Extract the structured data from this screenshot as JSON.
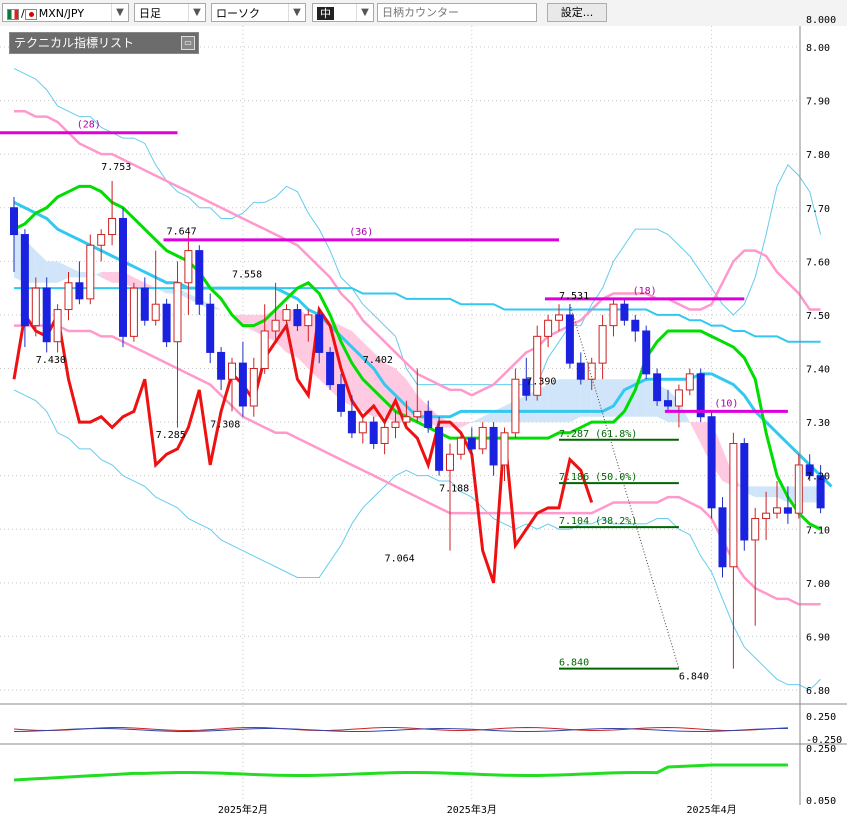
{
  "toolbar": {
    "pair": "MXN/JPY",
    "pair_separator": "/",
    "period": "日足",
    "chart_type": "ローソク",
    "size": "中",
    "counter_placeholder": "日柄カウンター",
    "settings_label": "設定..."
  },
  "indicator_panel": {
    "title": "テクニカル指標リスト"
  },
  "colors": {
    "up_candle": "#ffffff",
    "down_candle": "#1a22e0",
    "wick": "#cc2222",
    "ma_short": "#00dd00",
    "ma_long": "#33c8f0",
    "bollinger_outer": "#66ccee",
    "bollinger_inner": "#ff99cc",
    "cloud": "#ffc0dc",
    "cloud_alt": "#c8e0f8",
    "rsi_line": "#ee1111",
    "high_line": "#dd00dd",
    "fibonacci": "#006600"
  },
  "chart_data": {
    "type": "candlestick",
    "title": "",
    "instrument": "MXN/JPY",
    "timeframe": "daily",
    "y_range": [
      6.78,
      8.02
    ],
    "y_ticks": [
      "8.00",
      "7.90",
      "7.80",
      "7.70",
      "7.60",
      "7.50",
      "7.40",
      "7.30",
      "7.20",
      "7.10",
      "7.00",
      "6.90",
      "6.80"
    ],
    "y_top_partial": "8.000",
    "x_labels": [
      "2025年2月",
      "2025年3月",
      "2025年4月"
    ],
    "x_label_bars": [
      21,
      42,
      64
    ],
    "bars": 74,
    "candles": [
      {
        "o": 7.7,
        "h": 7.72,
        "l": 7.58,
        "c": 7.65
      },
      {
        "o": 7.65,
        "h": 7.66,
        "l": 7.44,
        "c": 7.48
      },
      {
        "o": 7.48,
        "h": 7.57,
        "l": 7.46,
        "c": 7.55
      },
      {
        "o": 7.55,
        "h": 7.57,
        "l": 7.43,
        "c": 7.45
      },
      {
        "o": 7.45,
        "h": 7.52,
        "l": 7.43,
        "c": 7.51
      },
      {
        "o": 7.51,
        "h": 7.58,
        "l": 7.49,
        "c": 7.56
      },
      {
        "o": 7.56,
        "h": 7.6,
        "l": 7.52,
        "c": 7.53
      },
      {
        "o": 7.53,
        "h": 7.65,
        "l": 7.52,
        "c": 7.63
      },
      {
        "o": 7.63,
        "h": 7.66,
        "l": 7.6,
        "c": 7.65
      },
      {
        "o": 7.65,
        "h": 7.75,
        "l": 7.63,
        "c": 7.68
      },
      {
        "o": 7.68,
        "h": 7.7,
        "l": 7.44,
        "c": 7.46
      },
      {
        "o": 7.46,
        "h": 7.56,
        "l": 7.45,
        "c": 7.55
      },
      {
        "o": 7.55,
        "h": 7.57,
        "l": 7.48,
        "c": 7.49
      },
      {
        "o": 7.49,
        "h": 7.62,
        "l": 7.48,
        "c": 7.52
      },
      {
        "o": 7.52,
        "h": 7.53,
        "l": 7.44,
        "c": 7.45
      },
      {
        "o": 7.45,
        "h": 7.6,
        "l": 7.29,
        "c": 7.56
      },
      {
        "o": 7.56,
        "h": 7.65,
        "l": 7.5,
        "c": 7.62
      },
      {
        "o": 7.62,
        "h": 7.63,
        "l": 7.5,
        "c": 7.52
      },
      {
        "o": 7.52,
        "h": 7.54,
        "l": 7.41,
        "c": 7.43
      },
      {
        "o": 7.43,
        "h": 7.44,
        "l": 7.36,
        "c": 7.38
      },
      {
        "o": 7.38,
        "h": 7.42,
        "l": 7.32,
        "c": 7.41
      },
      {
        "o": 7.41,
        "h": 7.45,
        "l": 7.31,
        "c": 7.33
      },
      {
        "o": 7.33,
        "h": 7.42,
        "l": 7.31,
        "c": 7.4
      },
      {
        "o": 7.4,
        "h": 7.52,
        "l": 7.39,
        "c": 7.47
      },
      {
        "o": 7.47,
        "h": 7.56,
        "l": 7.45,
        "c": 7.49
      },
      {
        "o": 7.49,
        "h": 7.52,
        "l": 7.47,
        "c": 7.51
      },
      {
        "o": 7.51,
        "h": 7.52,
        "l": 7.47,
        "c": 7.48
      },
      {
        "o": 7.48,
        "h": 7.51,
        "l": 7.45,
        "c": 7.5
      },
      {
        "o": 7.5,
        "h": 7.51,
        "l": 7.41,
        "c": 7.43
      },
      {
        "o": 7.43,
        "h": 7.44,
        "l": 7.36,
        "c": 7.37
      },
      {
        "o": 7.37,
        "h": 7.39,
        "l": 7.31,
        "c": 7.32
      },
      {
        "o": 7.32,
        "h": 7.35,
        "l": 7.27,
        "c": 7.28
      },
      {
        "o": 7.28,
        "h": 7.31,
        "l": 7.26,
        "c": 7.3
      },
      {
        "o": 7.3,
        "h": 7.31,
        "l": 7.25,
        "c": 7.26
      },
      {
        "o": 7.26,
        "h": 7.3,
        "l": 7.24,
        "c": 7.29
      },
      {
        "o": 7.29,
        "h": 7.32,
        "l": 7.27,
        "c": 7.3
      },
      {
        "o": 7.3,
        "h": 7.34,
        "l": 7.29,
        "c": 7.31
      },
      {
        "o": 7.31,
        "h": 7.4,
        "l": 7.3,
        "c": 7.32
      },
      {
        "o": 7.32,
        "h": 7.34,
        "l": 7.28,
        "c": 7.29
      },
      {
        "o": 7.29,
        "h": 7.31,
        "l": 7.2,
        "c": 7.21
      },
      {
        "o": 7.21,
        "h": 7.26,
        "l": 7.06,
        "c": 7.24
      },
      {
        "o": 7.24,
        "h": 7.28,
        "l": 7.23,
        "c": 7.27
      },
      {
        "o": 7.27,
        "h": 7.29,
        "l": 7.24,
        "c": 7.25
      },
      {
        "o": 7.25,
        "h": 7.3,
        "l": 7.24,
        "c": 7.29
      },
      {
        "o": 7.29,
        "h": 7.3,
        "l": 7.2,
        "c": 7.22
      },
      {
        "o": 7.22,
        "h": 7.29,
        "l": 7.19,
        "c": 7.28
      },
      {
        "o": 7.28,
        "h": 7.4,
        "l": 7.27,
        "c": 7.38
      },
      {
        "o": 7.38,
        "h": 7.42,
        "l": 7.34,
        "c": 7.35
      },
      {
        "o": 7.35,
        "h": 7.48,
        "l": 7.34,
        "c": 7.46
      },
      {
        "o": 7.46,
        "h": 7.5,
        "l": 7.44,
        "c": 7.49
      },
      {
        "o": 7.49,
        "h": 7.52,
        "l": 7.47,
        "c": 7.5
      },
      {
        "o": 7.5,
        "h": 7.52,
        "l": 7.4,
        "c": 7.41
      },
      {
        "o": 7.41,
        "h": 7.43,
        "l": 7.37,
        "c": 7.38
      },
      {
        "o": 7.38,
        "h": 7.42,
        "l": 7.36,
        "c": 7.41
      },
      {
        "o": 7.41,
        "h": 7.5,
        "l": 7.38,
        "c": 7.48
      },
      {
        "o": 7.48,
        "h": 7.53,
        "l": 7.46,
        "c": 7.52
      },
      {
        "o": 7.52,
        "h": 7.53,
        "l": 7.48,
        "c": 7.49
      },
      {
        "o": 7.49,
        "h": 7.5,
        "l": 7.45,
        "c": 7.47
      },
      {
        "o": 7.47,
        "h": 7.48,
        "l": 7.38,
        "c": 7.39
      },
      {
        "o": 7.39,
        "h": 7.4,
        "l": 7.33,
        "c": 7.34
      },
      {
        "o": 7.34,
        "h": 7.36,
        "l": 7.32,
        "c": 7.33
      },
      {
        "o": 7.33,
        "h": 7.37,
        "l": 7.29,
        "c": 7.36
      },
      {
        "o": 7.36,
        "h": 7.4,
        "l": 7.35,
        "c": 7.39
      },
      {
        "o": 7.39,
        "h": 7.4,
        "l": 7.3,
        "c": 7.31
      },
      {
        "o": 7.31,
        "h": 7.32,
        "l": 7.12,
        "c": 7.14
      },
      {
        "o": 7.14,
        "h": 7.16,
        "l": 7.01,
        "c": 7.03
      },
      {
        "o": 7.03,
        "h": 7.28,
        "l": 6.84,
        "c": 7.26
      },
      {
        "o": 7.26,
        "h": 7.27,
        "l": 7.06,
        "c": 7.08
      },
      {
        "o": 7.08,
        "h": 7.14,
        "l": 6.92,
        "c": 7.12
      },
      {
        "o": 7.12,
        "h": 7.17,
        "l": 7.08,
        "c": 7.13
      },
      {
        "o": 7.13,
        "h": 7.19,
        "l": 7.12,
        "c": 7.14
      },
      {
        "o": 7.14,
        "h": 7.18,
        "l": 7.11,
        "c": 7.13
      },
      {
        "o": 7.13,
        "h": 7.24,
        "l": 7.12,
        "c": 7.22
      },
      {
        "o": 7.22,
        "h": 7.24,
        "l": 7.19,
        "c": 7.2
      },
      {
        "o": 7.2,
        "h": 7.22,
        "l": 7.13,
        "c": 7.14
      }
    ],
    "ma_short": [
      7.66,
      7.67,
      7.69,
      7.7,
      7.72,
      7.73,
      7.74,
      7.74,
      7.73,
      7.71,
      7.7,
      7.68,
      7.66,
      7.64,
      7.62,
      7.61,
      7.6,
      7.58,
      7.55,
      7.53,
      7.5,
      7.48,
      7.48,
      7.49,
      7.51,
      7.53,
      7.55,
      7.56,
      7.54,
      7.5,
      7.45,
      7.41,
      7.38,
      7.36,
      7.34,
      7.32,
      7.31,
      7.3,
      7.29,
      7.28,
      7.27,
      7.27,
      7.27,
      7.27,
      7.27,
      7.27,
      7.27,
      7.27,
      7.27,
      7.27,
      7.28,
      7.28,
      7.29,
      7.3,
      7.3,
      7.3,
      7.32,
      7.36,
      7.42,
      7.45,
      7.47,
      7.47,
      7.47,
      7.47,
      7.46,
      7.45,
      7.44,
      7.42,
      7.38,
      7.28,
      7.2,
      7.16,
      7.13,
      7.11,
      7.1
    ],
    "ma_long": [
      7.71,
      7.7,
      7.69,
      7.68,
      7.66,
      7.65,
      7.64,
      7.63,
      7.62,
      7.61,
      7.6,
      7.59,
      7.58,
      7.57,
      7.56,
      7.56,
      7.55,
      7.55,
      7.55,
      7.55,
      7.55,
      7.55,
      7.55,
      7.55,
      7.55,
      7.54,
      7.53,
      7.51,
      7.5,
      7.48,
      7.46,
      7.44,
      7.42,
      7.4,
      7.37,
      7.35,
      7.33,
      7.31,
      7.31,
      7.31,
      7.31,
      7.32,
      7.32,
      7.32,
      7.32,
      7.32,
      7.32,
      7.32,
      7.32,
      7.32,
      7.32,
      7.32,
      7.32,
      7.32,
      7.32,
      7.33,
      7.36,
      7.37,
      7.38,
      7.38,
      7.38,
      7.38,
      7.38,
      7.39,
      7.39,
      7.38,
      7.37,
      7.35,
      7.32,
      7.3,
      7.28,
      7.26,
      7.24,
      7.22,
      7.2,
      7.18
    ],
    "ma_long2": [
      7.55,
      7.55,
      7.55,
      7.55,
      7.55,
      7.55,
      7.55,
      7.55,
      7.55,
      7.55,
      7.55,
      7.55,
      7.55,
      7.55,
      7.55,
      7.55,
      7.55,
      7.55,
      7.55,
      7.55,
      7.55,
      7.55,
      7.55,
      7.55,
      7.55,
      7.55,
      7.55,
      7.55,
      7.55,
      7.55,
      7.55,
      7.55,
      7.54,
      7.54,
      7.54,
      7.54,
      7.53,
      7.53,
      7.53,
      7.53,
      7.53,
      7.52,
      7.52,
      7.52,
      7.52,
      7.51,
      7.51,
      7.51,
      7.51,
      7.51,
      7.51,
      7.51,
      7.51,
      7.51,
      7.51,
      7.51,
      7.51,
      7.51,
      7.51,
      7.5,
      7.5,
      7.5,
      7.49,
      7.49,
      7.48,
      7.48,
      7.47,
      7.47,
      7.46,
      7.46,
      7.46,
      7.45,
      7.45,
      7.45,
      7.45
    ],
    "bb_upper2": [
      7.96,
      7.95,
      7.94,
      7.92,
      7.89,
      7.88,
      7.87,
      7.87,
      7.85,
      7.84,
      7.83,
      7.83,
      7.82,
      7.78,
      7.75,
      7.73,
      7.72,
      7.7,
      7.7,
      7.68,
      7.68,
      7.69,
      7.71,
      7.71,
      7.72,
      7.74,
      7.73,
      7.69,
      7.66,
      7.62,
      7.57,
      7.55,
      7.52,
      7.5,
      7.48,
      7.46,
      7.4,
      7.37,
      7.37,
      7.37,
      7.37,
      7.37,
      7.37,
      7.37,
      7.37,
      7.37,
      7.37,
      7.37,
      7.37,
      7.42,
      7.45,
      7.48,
      7.48,
      7.52,
      7.55,
      7.6,
      7.63,
      7.66,
      7.66,
      7.66,
      7.65,
      7.63,
      7.61,
      7.58,
      7.55,
      7.52,
      7.5,
      7.52,
      7.57,
      7.65,
      7.74,
      7.78,
      7.76,
      7.73,
      7.65
    ],
    "bb_upper1": [
      7.88,
      7.88,
      7.87,
      7.87,
      7.86,
      7.84,
      7.82,
      7.81,
      7.8,
      7.8,
      7.79,
      7.78,
      7.77,
      7.76,
      7.75,
      7.74,
      7.73,
      7.72,
      7.71,
      7.7,
      7.69,
      7.68,
      7.67,
      7.66,
      7.65,
      7.64,
      7.63,
      7.61,
      7.59,
      7.57,
      7.54,
      7.52,
      7.49,
      7.47,
      7.45,
      7.43,
      7.41,
      7.39,
      7.38,
      7.37,
      7.36,
      7.36,
      7.35,
      7.36,
      7.37,
      7.39,
      7.41,
      7.43,
      7.44,
      7.46,
      7.47,
      7.48,
      7.49,
      7.51,
      7.53,
      7.54,
      7.54,
      7.54,
      7.54,
      7.53,
      7.53,
      7.52,
      7.51,
      7.51,
      7.52,
      7.56,
      7.6,
      7.62,
      7.62,
      7.61,
      7.58,
      7.56,
      7.54,
      7.51,
      7.51
    ],
    "bb_lower1": [
      7.48,
      7.48,
      7.48,
      7.48,
      7.48,
      7.47,
      7.47,
      7.47,
      7.46,
      7.46,
      7.45,
      7.44,
      7.43,
      7.42,
      7.41,
      7.4,
      7.39,
      7.38,
      7.37,
      7.35,
      7.33,
      7.31,
      7.3,
      7.29,
      7.28,
      7.28,
      7.27,
      7.26,
      7.25,
      7.24,
      7.23,
      7.22,
      7.21,
      7.2,
      7.19,
      7.18,
      7.17,
      7.16,
      7.15,
      7.14,
      7.13,
      7.13,
      7.13,
      7.13,
      7.13,
      7.13,
      7.13,
      7.13,
      7.13,
      7.13,
      7.13,
      7.13,
      7.13,
      7.13,
      7.14,
      7.15,
      7.15,
      7.15,
      7.15,
      7.15,
      7.16,
      7.16,
      7.15,
      7.14,
      7.12,
      7.08,
      7.04,
      7.01,
      6.99,
      6.98,
      6.97,
      6.97,
      6.96,
      6.96,
      6.96
    ],
    "bb_lower2": [
      7.36,
      7.35,
      7.34,
      7.32,
      7.28,
      7.27,
      7.25,
      7.25,
      7.23,
      7.22,
      7.2,
      7.19,
      7.18,
      7.16,
      7.15,
      7.14,
      7.12,
      7.11,
      7.1,
      7.08,
      7.07,
      7.06,
      7.05,
      7.04,
      7.03,
      7.02,
      7.01,
      7.01,
      7.01,
      7.04,
      7.07,
      7.11,
      7.14,
      7.16,
      7.18,
      7.2,
      7.21,
      7.2,
      7.2,
      7.19,
      7.19,
      7.17,
      7.16,
      7.14,
      7.12,
      7.11,
      7.1,
      7.11,
      7.1,
      7.11,
      7.1,
      7.1,
      7.11,
      7.11,
      7.12,
      7.11,
      7.11,
      7.11,
      7.11,
      7.12,
      7.12,
      7.1,
      7.09,
      7.05,
      7.02,
      6.97,
      6.92,
      6.88,
      6.86,
      6.84,
      6.82,
      6.81,
      6.81,
      6.8,
      6.82
    ],
    "cloud_a": [
      7.67,
      7.64,
      7.62,
      7.6,
      7.6,
      7.59,
      7.58,
      7.58,
      7.57,
      7.56,
      7.56,
      7.55,
      7.55,
      7.55,
      7.55,
      7.55,
      7.54,
      7.53,
      7.52,
      7.51,
      7.5,
      7.48,
      7.47,
      7.46,
      7.45,
      7.43,
      7.42,
      7.4,
      7.38,
      7.36,
      7.34,
      7.33,
      7.32,
      7.31,
      7.31,
      7.3,
      7.3,
      7.3,
      7.3,
      7.29,
      7.29,
      7.29,
      7.3,
      7.31,
      7.32,
      7.33,
      7.34,
      7.35,
      7.36,
      7.37,
      7.38,
      7.38,
      7.38,
      7.38,
      7.38,
      7.38,
      7.38,
      7.38,
      7.38,
      7.37,
      7.36,
      7.34,
      7.3,
      7.26,
      7.22,
      7.19,
      7.18,
      7.18,
      7.18,
      7.18,
      7.18,
      7.18,
      7.18,
      7.18,
      7.18
    ],
    "cloud_b": [
      7.57,
      7.56,
      7.56,
      7.56,
      7.56,
      7.57,
      7.57,
      7.57,
      7.58,
      7.58,
      7.58,
      7.57,
      7.56,
      7.55,
      7.54,
      7.54,
      7.53,
      7.52,
      7.51,
      7.51,
      7.5,
      7.5,
      7.5,
      7.5,
      7.51,
      7.51,
      7.51,
      7.5,
      7.5,
      7.49,
      7.48,
      7.47,
      7.45,
      7.43,
      7.41,
      7.4,
      7.38,
      7.35,
      7.33,
      7.31,
      7.3,
      7.3,
      7.3,
      7.3,
      7.3,
      7.3,
      7.3,
      7.3,
      7.3,
      7.3,
      7.3,
      7.3,
      7.31,
      7.31,
      7.31,
      7.31,
      7.31,
      7.31,
      7.31,
      7.31,
      7.3,
      7.3,
      7.3,
      7.3,
      7.3,
      7.25,
      7.2,
      7.17,
      7.16,
      7.16,
      7.16,
      7.15,
      7.15,
      7.15,
      7.15
    ],
    "rsi_overlay": [
      7.38,
      7.5,
      7.47,
      7.46,
      7.5,
      7.38,
      7.3,
      7.3,
      7.31,
      7.29,
      7.31,
      7.32,
      7.38,
      7.22,
      7.24,
      7.25,
      7.29,
      7.36,
      7.22,
      7.32,
      7.39,
      7.37,
      7.34,
      7.42,
      7.45,
      7.48,
      7.38,
      7.35,
      7.51,
      7.48,
      7.4,
      7.34,
      7.31,
      7.33,
      7.3,
      7.34,
      7.29,
      7.27,
      7.22,
      7.3,
      7.3,
      7.28,
      7.24,
      7.06,
      7.0,
      7.28,
      7.07,
      7.1,
      7.13,
      7.14,
      7.14,
      7.23,
      7.21,
      7.15
    ],
    "price_labels": [
      {
        "text": "7.753"
      },
      {
        "text": "7.647"
      },
      {
        "text": "7.558"
      },
      {
        "text": "7.430"
      },
      {
        "text": "7.285"
      },
      {
        "text": "7.308"
      },
      {
        "text": "7.402"
      },
      {
        "text": "7.064"
      },
      {
        "text": "7.188"
      },
      {
        "text": "7.390"
      },
      {
        "text": "7.531"
      },
      {
        "text": "6.840"
      }
    ],
    "high_lines": [
      {
        "label": "(28)",
        "value": 7.84
      },
      {
        "label": "(36)",
        "value": 7.64
      },
      {
        "label": "(18)",
        "value": 7.53
      },
      {
        "label": "(10)",
        "value": 7.32
      }
    ],
    "fibonacci": [
      {
        "label": "7.287 (61.8%)",
        "value": 7.267
      },
      {
        "label": "7.186 (50.0%)",
        "value": 7.186
      },
      {
        "label": "7.104 (38.2%)",
        "value": 7.104
      },
      {
        "label": "6.840",
        "value": 6.84
      }
    ],
    "sub1_ticks": [
      "0.250",
      "-0.250"
    ],
    "sub2_ticks": [
      "0.250",
      "0.050"
    ]
  }
}
